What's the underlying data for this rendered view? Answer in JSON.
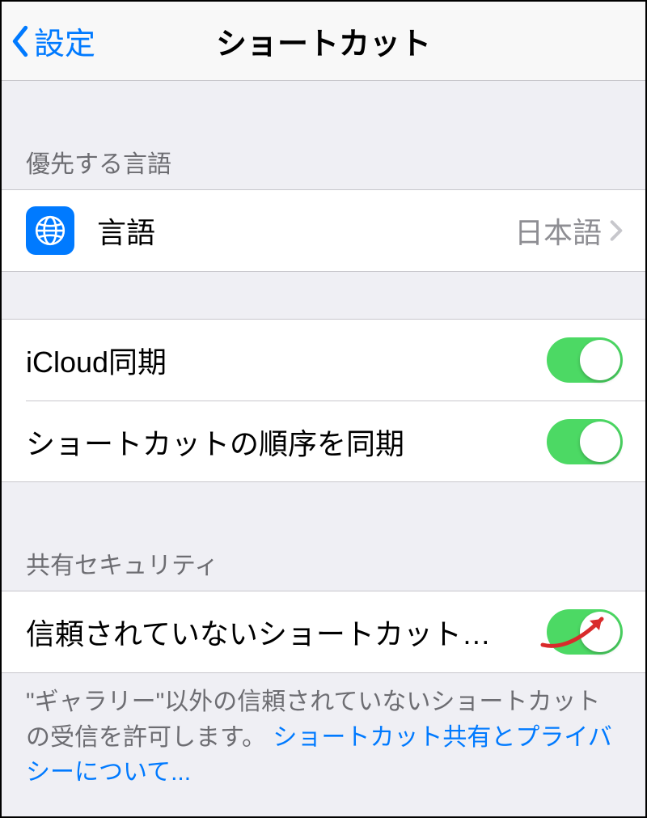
{
  "nav": {
    "back_label": "設定",
    "title": "ショートカット"
  },
  "sections": {
    "preferred_language_header": "優先する言語",
    "language": {
      "label": "言語",
      "value": "日本語"
    },
    "icloud_sync_label": "iCloud同期",
    "sync_order_label": "ショートカットの順序を同期",
    "sharing_security_header": "共有セキュリティ",
    "untrusted_label": "信頼されていないショートカット…",
    "footer_text": "\"ギャラリー\"以外の信頼されていないショートカットの受信を許可します。 ",
    "footer_link": "ショートカット共有とプライバシーについて..."
  },
  "toggles": {
    "icloud_sync": true,
    "sync_order": true,
    "untrusted": true
  }
}
